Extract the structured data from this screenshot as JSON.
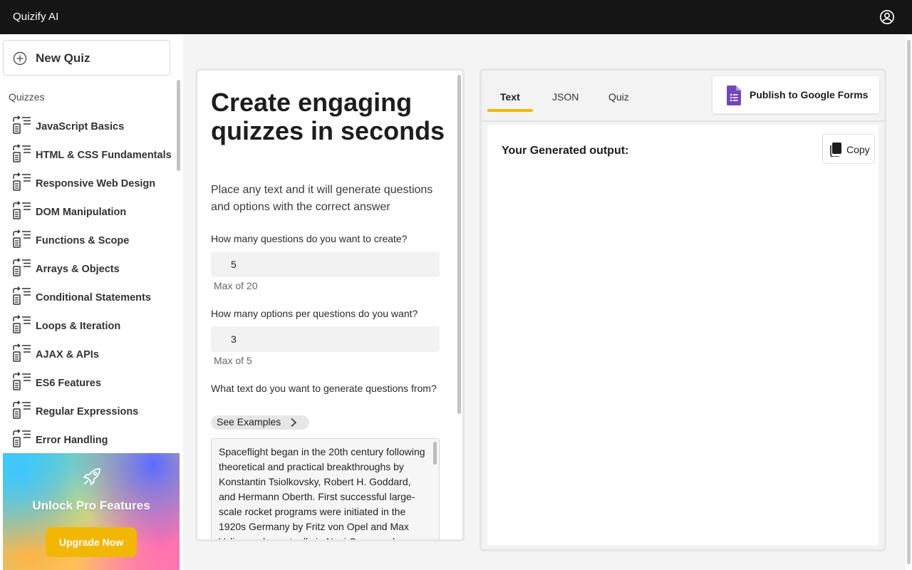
{
  "app": {
    "title": "Quizify AI"
  },
  "sidebar": {
    "new_quiz_label": "New Quiz",
    "section_title": "Quizzes",
    "items": [
      {
        "label": "JavaScript Basics"
      },
      {
        "label": "HTML & CSS Fundamentals"
      },
      {
        "label": "Responsive Web Design"
      },
      {
        "label": "DOM Manipulation"
      },
      {
        "label": "Functions & Scope"
      },
      {
        "label": "Arrays & Objects"
      },
      {
        "label": "Conditional Statements"
      },
      {
        "label": "Loops & Iteration"
      },
      {
        "label": "AJAX & APIs"
      },
      {
        "label": "ES6 Features"
      },
      {
        "label": "Regular Expressions"
      },
      {
        "label": "Error Handling"
      }
    ],
    "promo": {
      "title": "Unlock Pro Features",
      "button_label": "Upgrade Now"
    }
  },
  "form": {
    "title": "Create engaging quizzes in seconds",
    "subtitle": "Place any text and it will generate questions and options with the correct answer",
    "questions": {
      "label": "How many questions do you want to create?",
      "value": "5",
      "hint": "Max of 20"
    },
    "options": {
      "label": "How many options per questions do you want?",
      "value": "3",
      "hint": "Max of 5"
    },
    "source": {
      "label": "What text do you want to generate questions from?",
      "examples_label": "See Examples",
      "text": "Spaceflight began in the 20th century following theoretical and practical breakthroughs by Konstantin Tsiolkovsky, Robert H. Goddard, and Hermann Oberth. First successful large-scale rocket programs were initiated in the 1920s Germany by Fritz von Opel and Max Valier, and eventually in Nazi Germany by Wernher von Braun."
    }
  },
  "output": {
    "tabs": [
      {
        "label": "Text"
      },
      {
        "label": "JSON"
      },
      {
        "label": "Quiz"
      }
    ],
    "active_tab": "Text",
    "publish_label": "Publish to Google Forms",
    "heading": "Your Generated output:",
    "copy_label": "Copy"
  },
  "colors": {
    "accent": "#f2b705",
    "topbar": "#151515",
    "forms_purple": "#7248b9"
  }
}
